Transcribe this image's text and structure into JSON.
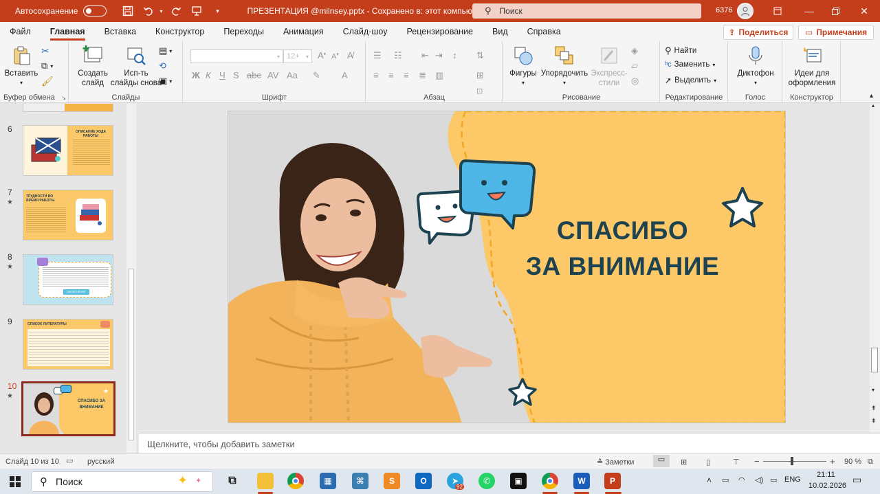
{
  "titlebar": {
    "autosave_label": "Автосохранение",
    "autosave_state": "Откл.",
    "doc_title": "ПРЕЗЕНТАЦИЯ @milnsey.pptx  -  Сохранено в: этот компьютер",
    "search_placeholder": "Поиск",
    "user_count": "6376",
    "accent": "#c43e1c"
  },
  "menu": {
    "tabs": [
      "Файл",
      "Главная",
      "Вставка",
      "Конструктор",
      "Переходы",
      "Анимация",
      "Слайд-шоу",
      "Рецензирование",
      "Вид",
      "Справка"
    ],
    "active_tab": "Главная",
    "share": "Поделиться",
    "comments": "Примечания"
  },
  "ribbon": {
    "clipboard": {
      "paste": "Вставить",
      "label": "Буфер обмена"
    },
    "slides": {
      "new_slide": "Создать\nслайд",
      "reuse": "Исп-ть\nслайды снова",
      "label": "Слайды"
    },
    "font": {
      "size": "12+",
      "label": "Шрифт"
    },
    "paragraph": {
      "label": "Абзац"
    },
    "drawing": {
      "shapes": "Фигуры",
      "arrange": "Упорядочить",
      "quick_styles": "Экспресс-\nстили",
      "label": "Рисование"
    },
    "editing": {
      "find": "Найти",
      "replace": "Заменить",
      "select": "Выделить",
      "label": "Редактирование"
    },
    "voice": {
      "dictate": "Диктофон",
      "label": "Голос"
    },
    "designer": {
      "ideas": "Идеи для\nоформления",
      "label": "Конструктор"
    }
  },
  "thumbnails": [
    {
      "num": "6",
      "star": false,
      "title": "ОПИСАНИЕ ХОДА РАБОТЫ"
    },
    {
      "num": "7",
      "star": true,
      "title": "ТРУДНОСТИ ВО ВРЕМЯ РАБОТЫ"
    },
    {
      "num": "8",
      "star": true,
      "title": "ЗАКЛЮЧЕНИЕ"
    },
    {
      "num": "9",
      "star": false,
      "title": "СПИСОК ЛИТЕРАТУРЫ"
    },
    {
      "num": "10",
      "star": true,
      "title": "СПАСИБО ЗА ВНИМАНИЕ",
      "selected": true
    }
  ],
  "slide": {
    "line1": "СПАСИБО",
    "line2": "ЗА ВНИМАНИЕ",
    "bg_color": "#fcc868",
    "text_color": "#1d4350"
  },
  "notes_placeholder": "Щелкните, чтобы добавить заметки",
  "status": {
    "slide_counter": "Слайд 10 из 10",
    "language": "русский",
    "notes_btn": "Заметки",
    "zoom": "90 %"
  },
  "taskbar": {
    "search": "Поиск",
    "lang": "ENG",
    "time": "21:11",
    "date": "10.02.2026",
    "telegram_badge": "92"
  }
}
